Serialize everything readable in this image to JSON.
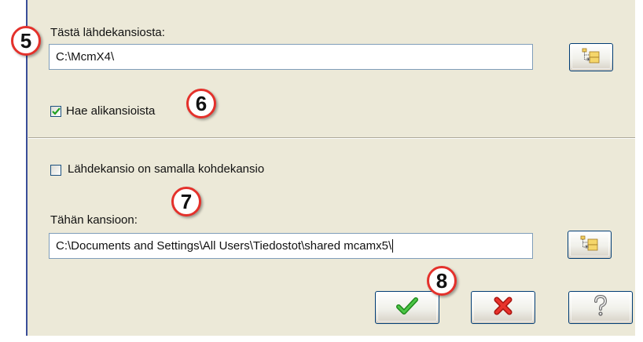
{
  "source": {
    "label": "Tästä lähdekansiosta:",
    "value": "C:\\McmX4\\"
  },
  "subfolders": {
    "label": "Hae alikansioista",
    "checked": true
  },
  "same_folder": {
    "label": "Lähdekansio on samalla kohdekansio",
    "checked": false
  },
  "target": {
    "label": "Tähän kansioon:",
    "value": "C:\\Documents and Settings\\All Users\\Tiedostot\\shared mcamx5\\"
  },
  "markers": [
    "5",
    "6",
    "7",
    "8"
  ],
  "icons": {
    "browse": "folder-tree-icon",
    "ok": "green-checkmark-icon",
    "cancel": "red-x-icon",
    "help": "question-mark-icon"
  },
  "colors": {
    "dialog_bg": "#ece9d8",
    "frame_line": "#3a4d98",
    "marker_ring": "#e4312b",
    "ok_green": "#2ea42a",
    "cancel_red": "#d9231c"
  }
}
